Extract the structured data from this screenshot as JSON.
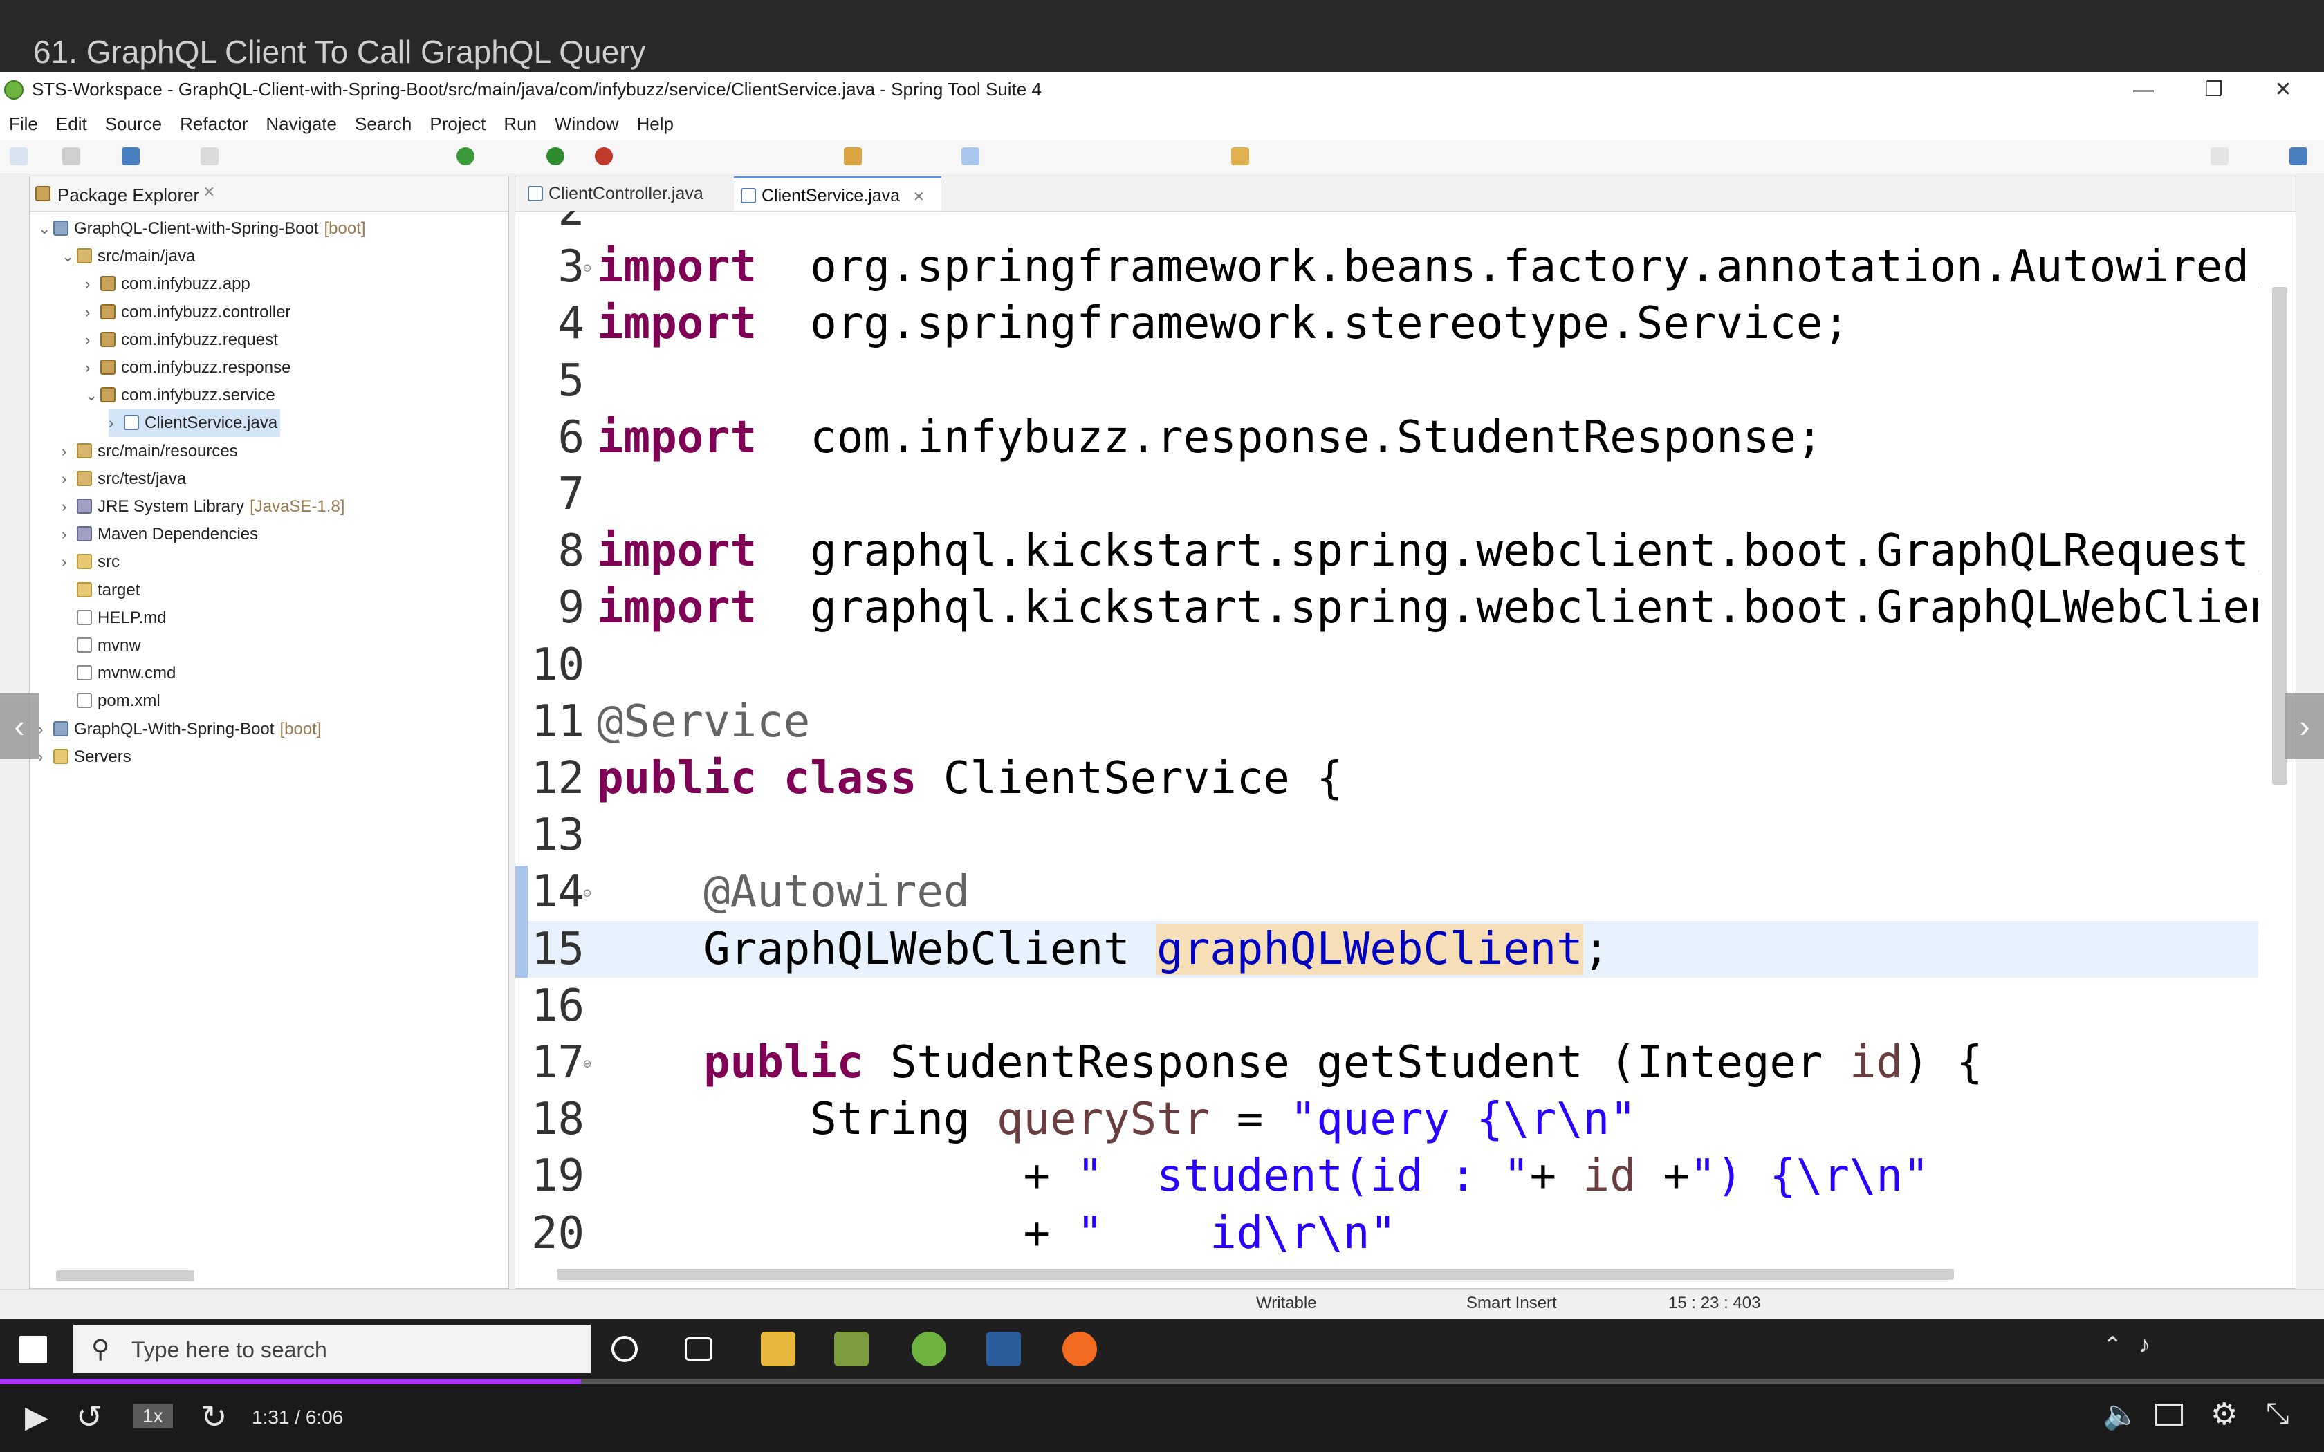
{
  "video": {
    "title": "61. GraphQL Client To Call GraphQL Query",
    "time": "1:31 / 6:06",
    "speed": "1x",
    "progress_fraction": 0.25
  },
  "window": {
    "title": "STS-Workspace - GraphQL-Client-with-Spring-Boot/src/main/java/com/infybuzz/service/ClientService.java - Spring Tool Suite 4",
    "minimize": "—",
    "restore": "❐",
    "close": "✕"
  },
  "menu": [
    "File",
    "Edit",
    "Source",
    "Refactor",
    "Navigate",
    "Search",
    "Project",
    "Run",
    "Window",
    "Help"
  ],
  "explorer": {
    "tab_label": "Package Explorer",
    "tab_close": "✕",
    "tree": [
      {
        "label": "GraphQL-Client-with-Spring-Boot",
        "deco": "[boot]",
        "twisty": "⌄",
        "icon": "project"
      },
      {
        "label": "src/main/java",
        "deco": "",
        "twisty": "⌄",
        "icon": "srcfolder"
      },
      {
        "label": "com.infybuzz.app",
        "deco": "",
        "twisty": "›",
        "icon": "package"
      },
      {
        "label": "com.infybuzz.controller",
        "deco": "",
        "twisty": "›",
        "icon": "package"
      },
      {
        "label": "com.infybuzz.request",
        "deco": "",
        "twisty": "›",
        "icon": "package"
      },
      {
        "label": "com.infybuzz.response",
        "deco": "",
        "twisty": "›",
        "icon": "package"
      },
      {
        "label": "com.infybuzz.service",
        "deco": "",
        "twisty": "⌄",
        "icon": "package"
      },
      {
        "label": "ClientService.java",
        "deco": "",
        "twisty": "›",
        "icon": "java"
      },
      {
        "label": "src/main/resources",
        "deco": "",
        "twisty": "›",
        "icon": "srcfolder"
      },
      {
        "label": "src/test/java",
        "deco": "",
        "twisty": "›",
        "icon": "srcfolder"
      },
      {
        "label": "JRE System Library",
        "deco": "[JavaSE-1.8]",
        "twisty": "›",
        "icon": "lib"
      },
      {
        "label": "Maven Dependencies",
        "deco": "",
        "twisty": "›",
        "icon": "lib"
      },
      {
        "label": "src",
        "deco": "",
        "twisty": "›",
        "icon": "folder"
      },
      {
        "label": "target",
        "deco": "",
        "twisty": "",
        "icon": "folder"
      },
      {
        "label": "HELP.md",
        "deco": "",
        "twisty": "",
        "icon": "file"
      },
      {
        "label": "mvnw",
        "deco": "",
        "twisty": "",
        "icon": "file"
      },
      {
        "label": "mvnw.cmd",
        "deco": "",
        "twisty": "",
        "icon": "file"
      },
      {
        "label": "pom.xml",
        "deco": "",
        "twisty": "",
        "icon": "file"
      },
      {
        "label": "GraphQL-With-Spring-Boot",
        "deco": "[boot]",
        "twisty": "›",
        "icon": "project"
      },
      {
        "label": "Servers",
        "deco": "",
        "twisty": "›",
        "icon": "folder"
      }
    ]
  },
  "editor": {
    "tabs": [
      {
        "label": "ClientController.java",
        "active": false
      },
      {
        "label": "ClientService.java",
        "active": true,
        "close": "✕"
      }
    ],
    "lines": [
      {
        "n": "2",
        "fold": "",
        "segs": []
      },
      {
        "n": "3",
        "fold": "⊖",
        "segs": [
          [
            "kw",
            "import"
          ],
          [
            "",
            "  org.springframework.beans.factory.annotation.Autowired;"
          ]
        ]
      },
      {
        "n": "4",
        "fold": "",
        "segs": [
          [
            "kw",
            "import"
          ],
          [
            "",
            "  org.springframework.stereotype.Service;"
          ]
        ]
      },
      {
        "n": "5",
        "fold": "",
        "segs": []
      },
      {
        "n": "6",
        "fold": "",
        "segs": [
          [
            "kw",
            "import"
          ],
          [
            "",
            "  com.infybuzz.response.StudentResponse;"
          ]
        ]
      },
      {
        "n": "7",
        "fold": "",
        "segs": []
      },
      {
        "n": "8",
        "fold": "",
        "segs": [
          [
            "kw",
            "import"
          ],
          [
            "",
            "  graphql.kickstart.spring.webclient.boot.GraphQLRequest;"
          ]
        ]
      },
      {
        "n": "9",
        "fold": "",
        "segs": [
          [
            "kw",
            "import"
          ],
          [
            "",
            "  graphql.kickstart.spring.webclient.boot.GraphQLWebClien"
          ]
        ]
      },
      {
        "n": "10",
        "fold": "",
        "segs": []
      },
      {
        "n": "11",
        "fold": "",
        "segs": [
          [
            "ann",
            "@Service"
          ]
        ]
      },
      {
        "n": "12",
        "fold": "",
        "segs": [
          [
            "kw",
            "public"
          ],
          [
            "",
            " "
          ],
          [
            "kw",
            "class"
          ],
          [
            "",
            " ClientService {"
          ]
        ]
      },
      {
        "n": "13",
        "fold": "",
        "segs": []
      },
      {
        "n": "14",
        "fold": "⊖",
        "segs": [
          [
            "",
            "    "
          ],
          [
            "ann",
            "@Autowired"
          ]
        ]
      },
      {
        "n": "15",
        "fold": "",
        "current": true,
        "segs": [
          [
            "",
            "    GraphQLWebClient "
          ],
          [
            "hl",
            "graphQLWebClient"
          ],
          [
            "",
            ";"
          ]
        ]
      },
      {
        "n": "16",
        "fold": "",
        "segs": []
      },
      {
        "n": "17",
        "fold": "⊖",
        "segs": [
          [
            "",
            "    "
          ],
          [
            "kw",
            "public"
          ],
          [
            "",
            " StudentResponse getStudent (Integer "
          ],
          [
            "var",
            "id"
          ],
          [
            "",
            ") {"
          ]
        ]
      },
      {
        "n": "18",
        "fold": "",
        "segs": [
          [
            "",
            "        String "
          ],
          [
            "var",
            "queryStr"
          ],
          [
            "",
            " = "
          ],
          [
            "str",
            "\"query {\\r\\n\""
          ]
        ]
      },
      {
        "n": "19",
        "fold": "",
        "segs": [
          [
            "",
            "                + "
          ],
          [
            "str",
            "\"  student(id : \""
          ],
          [
            "",
            "+ "
          ],
          [
            "var",
            "id"
          ],
          [
            "",
            " +"
          ],
          [
            "str",
            "\") {\\r\\n\""
          ]
        ]
      },
      {
        "n": "20",
        "fold": "",
        "segs": [
          [
            "",
            "                + "
          ],
          [
            "str",
            "\"    id\\r\\n\""
          ]
        ]
      }
    ]
  },
  "status": {
    "writable": "Writable",
    "insert_mode": "Smart Insert",
    "position": "15 : 23 : 403"
  },
  "taskbar": {
    "search_placeholder": "Type here to search"
  },
  "colors": {
    "keyword": "#7f0055",
    "string": "#2a00ff",
    "annotation": "#646464",
    "accent_progress": "#a435f0"
  }
}
